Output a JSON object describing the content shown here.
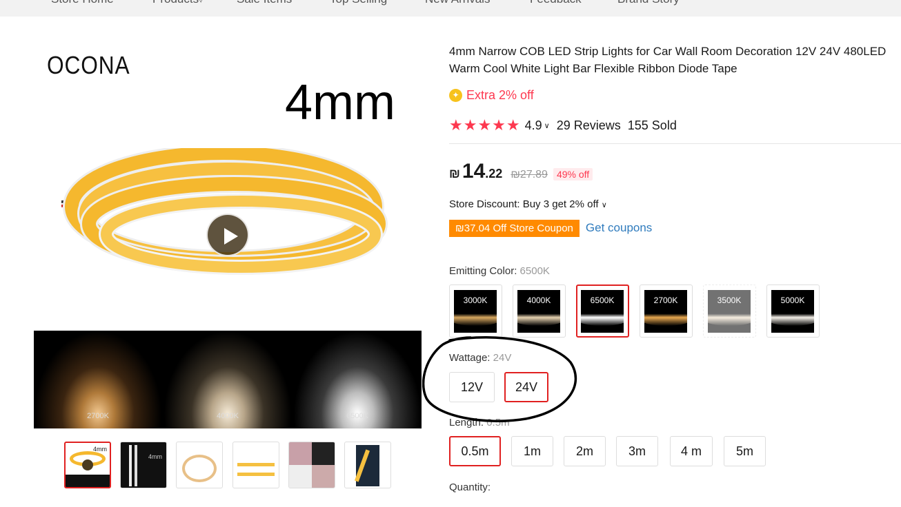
{
  "nav": {
    "items": [
      "Store Home",
      "Products",
      "Sale Items",
      "Top Selling",
      "New Arrivals",
      "Feedback",
      "Brand Story"
    ]
  },
  "gallery": {
    "brand": "OCONA",
    "size_label": "4mm",
    "samples": [
      "2700K",
      "4000K",
      "6500K"
    ],
    "thumb_main_label": "4mm",
    "thumb_second_label": "4mm"
  },
  "product": {
    "title_line1": "4mm Narrow COB LED Strip Lights for Car Wall Room Decoration 12V 24V 480LED",
    "title_line2": "Warm Cool White Light Bar Flexible Ribbon Diode Tape",
    "extra_off": "Extra 2% off",
    "rating": "4.9",
    "rating_stars": 5,
    "reviews": "29 Reviews",
    "sold": "155 Sold",
    "currency": "₪",
    "price_int": "14",
    "price_dec": ".22",
    "old_price": "₪27.89",
    "discount": "49% off",
    "store_discount": "Store Discount: Buy 3 get 2% off",
    "coupon": "₪37.04 Off Store Coupon",
    "get_coupons": "Get coupons"
  },
  "options": {
    "color_label": "Emitting Color:",
    "color_selected": "6500K",
    "colors": [
      "3000K",
      "4000K",
      "6500K",
      "2700K",
      "3500K",
      "5000K"
    ],
    "wattage_label": "Wattage:",
    "wattage_selected": "24V",
    "wattages": [
      "12V",
      "24V"
    ],
    "length_label": "Length:",
    "length_selected": "0.5m",
    "lengths": [
      "0.5m",
      "1m",
      "2m",
      "3m",
      "4 m",
      "5m"
    ],
    "quantity_label": "Quantity:"
  },
  "colors": {
    "accent_red": "#e02020",
    "price_red": "#fd384f",
    "coupon_orange": "#ff8a00",
    "link_blue": "#2f7bbd",
    "strip_yellow": "#f5b82e"
  }
}
